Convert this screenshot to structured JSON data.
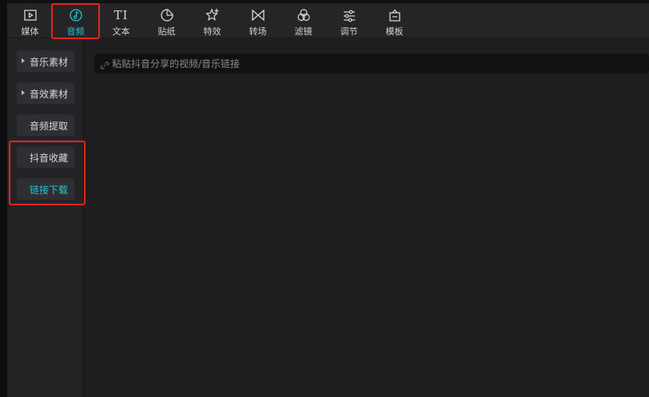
{
  "tabs": [
    {
      "id": "media",
      "label": "媒体",
      "icon": "media-play-icon",
      "active": false
    },
    {
      "id": "audio",
      "label": "音频",
      "icon": "music-note-icon",
      "active": true
    },
    {
      "id": "text",
      "label": "文本",
      "icon": "text-ti-icon",
      "active": false
    },
    {
      "id": "sticker",
      "label": "贴纸",
      "icon": "sticker-icon",
      "active": false
    },
    {
      "id": "effects",
      "label": "特效",
      "icon": "star-effect-icon",
      "active": false
    },
    {
      "id": "transition",
      "label": "转场",
      "icon": "bowtie-transition-icon",
      "active": false
    },
    {
      "id": "filter",
      "label": "滤镜",
      "icon": "circles-filter-icon",
      "active": false
    },
    {
      "id": "adjust",
      "label": "调节",
      "icon": "sliders-adjust-icon",
      "active": false
    },
    {
      "id": "template",
      "label": "模板",
      "icon": "template-box-icon",
      "active": false
    }
  ],
  "tab_icon_text": "TI",
  "sidebar": {
    "items": [
      {
        "label": "音乐素材",
        "expandable": true,
        "active": false
      },
      {
        "label": "音效素材",
        "expandable": true,
        "active": false
      },
      {
        "label": "音频提取",
        "expandable": false,
        "active": false
      },
      {
        "label": "抖音收藏",
        "expandable": false,
        "active": false
      },
      {
        "label": "链接下载",
        "expandable": false,
        "active": true
      }
    ]
  },
  "link_input": {
    "placeholder": "粘贴抖音分享的视频/音乐链接",
    "value": ""
  },
  "colors": {
    "accent": "#21c5d6",
    "highlight": "#e8231d",
    "panel_bg": "#1e1e21",
    "toolbar_bg": "#252528"
  }
}
